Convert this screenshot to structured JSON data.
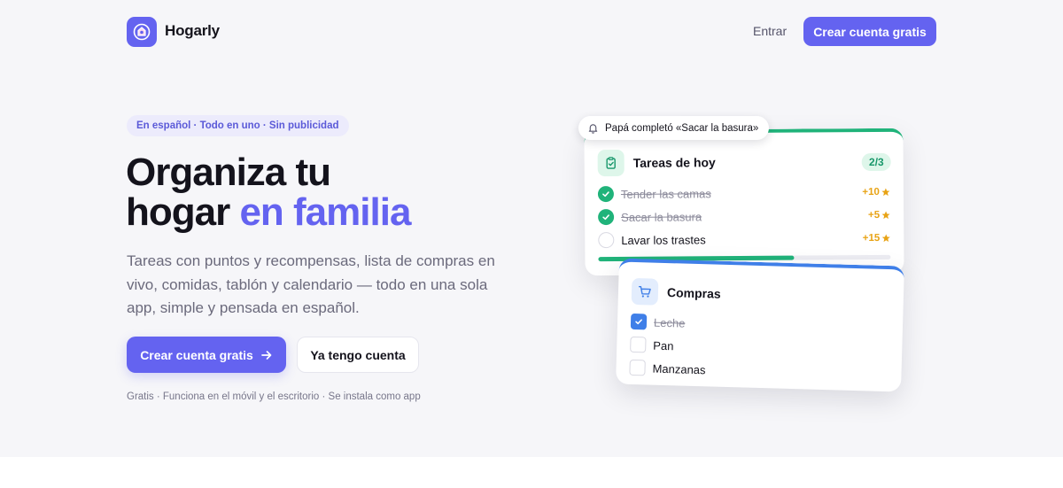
{
  "colors": {
    "brand": "#6463f0",
    "success": "#20b37a",
    "info": "#3f7fe8",
    "points": "#e8a315"
  },
  "header": {
    "logo_icon": "hogarly-logo-icon",
    "brand_name": "Hogarly",
    "login_label": "Entrar",
    "signup_label": "Crear cuenta gratis"
  },
  "hero": {
    "pill": "En español · Todo en uno · Sin publicidad",
    "title_line1": "Organiza tu",
    "title_line2_plain": "hogar ",
    "title_line2_accent": "en familia",
    "description": "Tareas con puntos y recompensas, lista de compras en vivo, comidas, tablón y calendario — todo en una sola app, simple y pensada en español.",
    "primary_cta": "Crear cuenta gratis",
    "primary_cta_icon": "arrow-right-icon",
    "secondary_cta": "Ya tengo cuenta",
    "note": "Gratis · Funciona en el móvil y el escritorio · Se instala como app"
  },
  "notification": {
    "icon": "bell-icon",
    "text": "Papá completó «Sacar la basura»"
  },
  "tasks_card": {
    "icon": "clipboard-check-icon",
    "title": "Tareas de hoy",
    "count": "2/3",
    "progress": 0.67,
    "items": [
      {
        "label": "Tender las camas",
        "points": "+10",
        "done": true
      },
      {
        "label": "Sacar la basura",
        "points": "+5",
        "done": true
      },
      {
        "label": "Lavar los trastes",
        "points": "+15",
        "done": false
      }
    ]
  },
  "shopping_card": {
    "icon": "shopping-cart-icon",
    "title": "Compras",
    "items": [
      {
        "label": "Leche",
        "done": true
      },
      {
        "label": "Pan",
        "done": false
      },
      {
        "label": "Manzanas",
        "done": false
      }
    ]
  }
}
